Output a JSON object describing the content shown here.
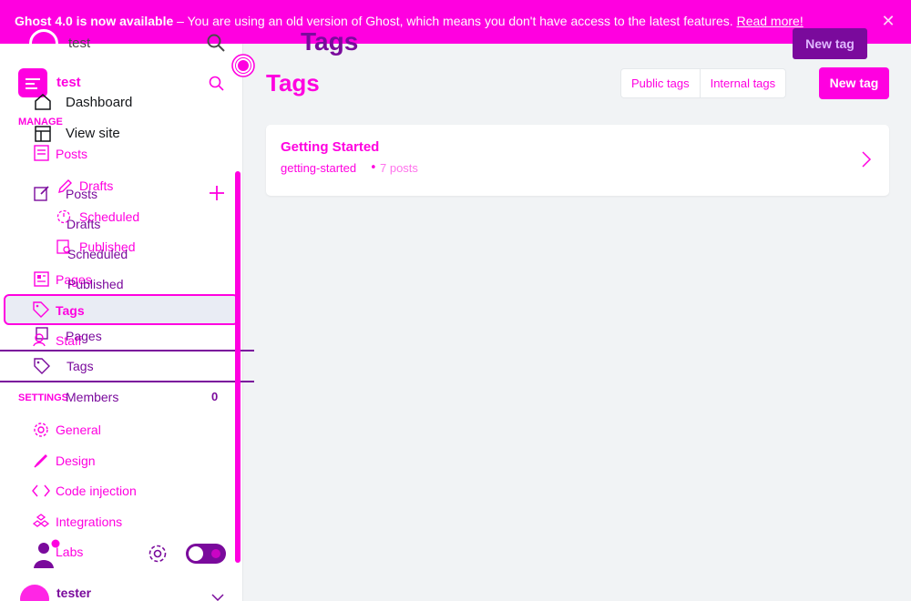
{
  "banner": {
    "title": "Ghost 4.0 is now available",
    "message": " – You are using an old version of Ghost, which means you don't have access to the latest features. ",
    "link": "Read more!",
    "close": "✕"
  },
  "overlay": {
    "site_title": "test",
    "page_title": "Tags",
    "new_tag_label": "New tag"
  },
  "site": {
    "title": "test"
  },
  "sidebar": {
    "section_manage": "MANAGE",
    "section_settings": "SETTINGS",
    "dashboard": "Dashboard",
    "view_site": "View site",
    "posts": "Posts",
    "posts_secondary": "Posts",
    "drafts": "Drafts",
    "drafts_secondary": "Drafts",
    "scheduled": "Scheduled",
    "scheduled_secondary": "Scheduled",
    "published": "Published",
    "published_secondary": "Published",
    "pages": "Pages",
    "pages_secondary": "Pages",
    "tags": "Tags",
    "tags_secondary": "Tags",
    "staff": "Staff",
    "members": "Members",
    "members_count": "0",
    "general": "General",
    "design": "Design",
    "code_injection": "Code injection",
    "integrations": "Integrations",
    "labs": "Labs"
  },
  "user": {
    "name": "tester"
  },
  "main": {
    "title": "Tags",
    "filter_public": "Public tags",
    "filter_internal": "Internal tags",
    "new_tag": "New tag",
    "tags": [
      {
        "name": "Getting Started",
        "slug": "getting-started",
        "separator": "•",
        "count": "7 posts"
      }
    ]
  },
  "colors": {
    "accent": "#ff00e0",
    "secondary": "#7a0a9c",
    "background": "#f1f3f5"
  }
}
